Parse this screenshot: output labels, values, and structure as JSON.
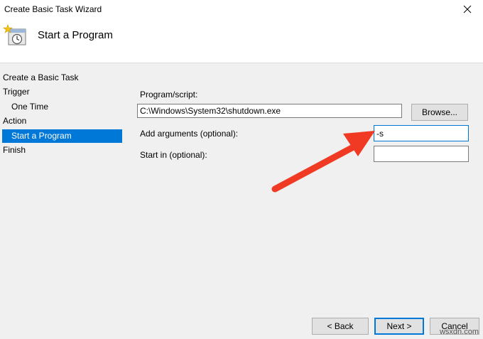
{
  "window": {
    "title": "Create Basic Task Wizard"
  },
  "header": {
    "title": "Start a Program",
    "icon": "task-scheduler-clock-icon"
  },
  "sidebar": {
    "items": [
      {
        "label": "Create a Basic Task"
      },
      {
        "label": "Trigger"
      },
      {
        "label": "One Time"
      },
      {
        "label": "Action"
      },
      {
        "label": "Start a Program",
        "selected": true
      },
      {
        "label": "Finish"
      }
    ]
  },
  "form": {
    "program_label": "Program/script:",
    "program_value": "C:\\Windows\\System32\\shutdown.exe",
    "browse_label": "Browse...",
    "args_label": "Add arguments (optional):",
    "args_value": "-s",
    "startin_label": "Start in (optional):",
    "startin_value": ""
  },
  "footer": {
    "back_label": "< Back",
    "next_label": "Next >",
    "cancel_label": "Cancel"
  },
  "annotation": {
    "arrow_color": "#f03a24"
  },
  "watermark": "wsxdn.com"
}
